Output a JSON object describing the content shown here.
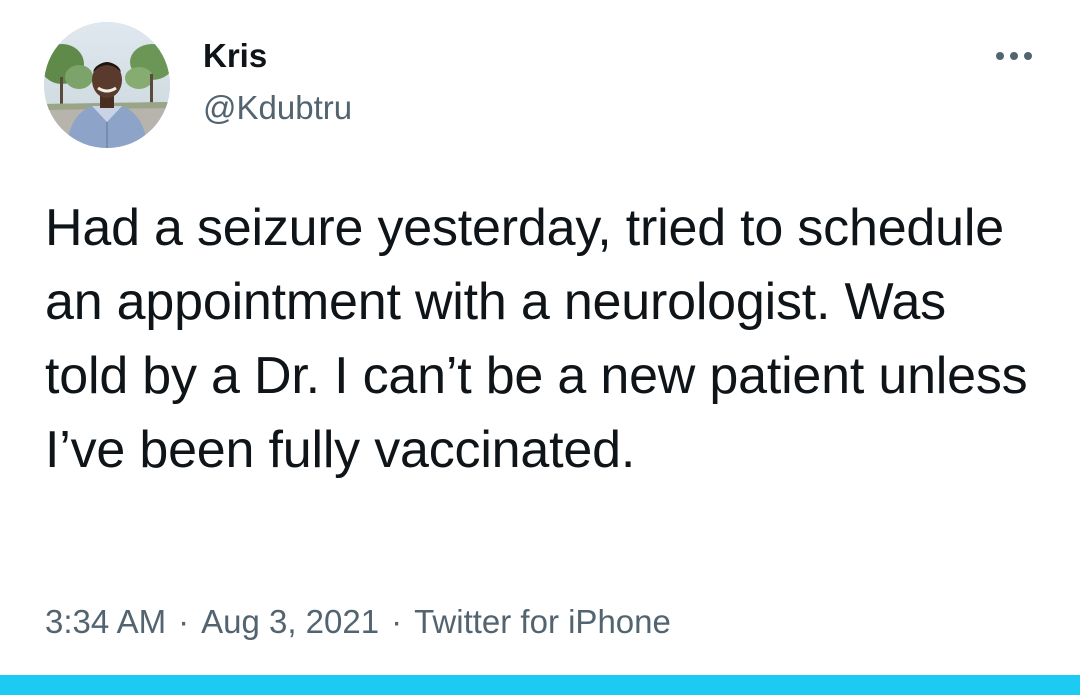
{
  "tweet": {
    "author": {
      "display_name": "Kris",
      "handle": "@Kdubtru",
      "avatar": "profile-photo"
    },
    "more_icon": "more-horizontal-icon",
    "text": "Had a seizure yesterday, tried to schedule an appointment with a neurologist. Was told by a Dr. I can’t be a new patient unless I’ve been fully vaccinated.",
    "time": "3:34 AM",
    "date": "Aug 3, 2021",
    "separator": "·",
    "source": "Twitter for iPhone"
  },
  "colors": {
    "text_primary": "#0f1419",
    "text_secondary": "#536471",
    "bottom_bar": "#1dcaf2",
    "background": "#ffffff"
  }
}
